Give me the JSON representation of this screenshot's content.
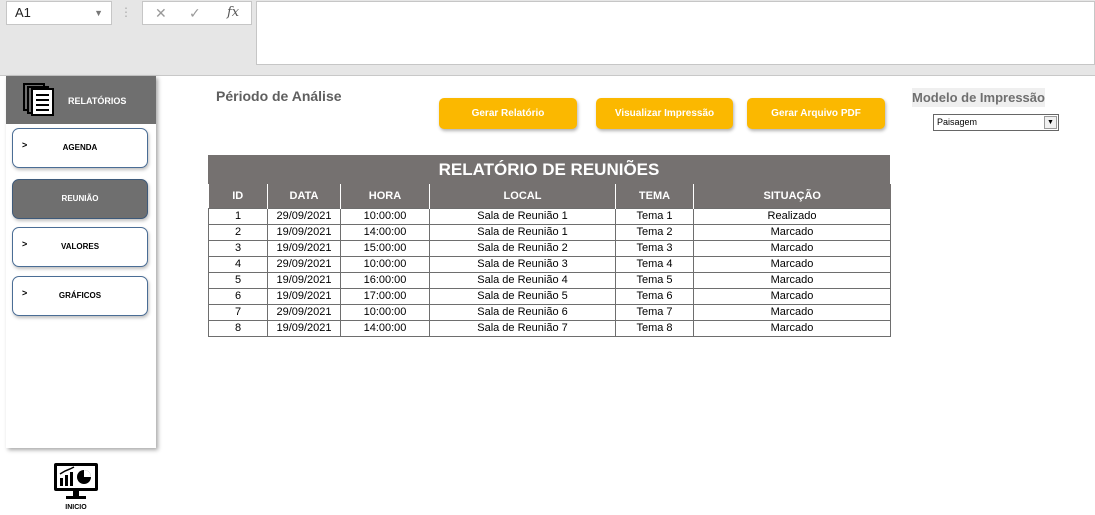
{
  "formula_bar": {
    "cell_ref": "A1",
    "fx_symbol": "fx",
    "formula_value": ""
  },
  "sidebar": {
    "header_label": "RELATÓRIOS",
    "items": [
      {
        "label": "AGENDA",
        "chevron": ">",
        "active": false
      },
      {
        "label": "REUNIÃO",
        "chevron": "",
        "active": true
      },
      {
        "label": "VALORES",
        "chevron": ">",
        "active": false
      },
      {
        "label": "GRÁFICOS",
        "chevron": ">",
        "active": false
      }
    ],
    "home_label": "INICIO"
  },
  "controls": {
    "periodo_label": "Périodo de Análise",
    "btn_gerar": "Gerar Relatório",
    "btn_visualizar": "Visualizar Impressão",
    "btn_pdf": "Gerar Arquivo PDF",
    "modelo_title": "Modelo de Impressão",
    "modelo_selected": "Paisagem"
  },
  "report": {
    "title": "RELATÓRIO DE REUNIÕES",
    "columns": [
      "ID",
      "DATA",
      "HORA",
      "LOCAL",
      "TEMA",
      "SITUAÇÃO"
    ],
    "rows": [
      [
        "1",
        "29/09/2021",
        "10:00:00",
        "Sala de Reunião 1",
        "Tema 1",
        "Realizado"
      ],
      [
        "2",
        "19/09/2021",
        "14:00:00",
        "Sala de Reunião 1",
        "Tema 2",
        "Marcado"
      ],
      [
        "3",
        "19/09/2021",
        "15:00:00",
        "Sala de Reunião 2",
        "Tema 3",
        "Marcado"
      ],
      [
        "4",
        "29/09/2021",
        "10:00:00",
        "Sala de Reunião 3",
        "Tema 4",
        "Marcado"
      ],
      [
        "5",
        "19/09/2021",
        "16:00:00",
        "Sala de Reunião 4",
        "Tema 5",
        "Marcado"
      ],
      [
        "6",
        "19/09/2021",
        "17:00:00",
        "Sala de Reunião 5",
        "Tema 6",
        "Marcado"
      ],
      [
        "7",
        "29/09/2021",
        "10:00:00",
        "Sala de Reunião 6",
        "Tema 7",
        "Marcado"
      ],
      [
        "8",
        "19/09/2021",
        "14:00:00",
        "Sala de Reunião 7",
        "Tema 8",
        "Marcado"
      ]
    ]
  },
  "colors": {
    "accent_button": "#fbb800",
    "header_gray": "#757170",
    "sidebar_gray": "#6f6f6f"
  }
}
